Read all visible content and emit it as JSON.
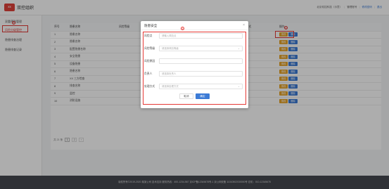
{
  "header": {
    "logo_text": "XX",
    "app_title": "双控组织",
    "user_text": "北京双控科技（示意）",
    "sep": "|",
    "user_name": "管理账号",
    "change_password": "修改密码",
    "logout": "退出"
  },
  "sidebar": {
    "items": [
      {
        "label": "双重预防管理"
      },
      {
        "label": "风险分级管控"
      },
      {
        "label": "隐患排查治理"
      },
      {
        "label": "隐患排查记录"
      }
    ],
    "mark": "①"
  },
  "table": {
    "headers": [
      "序号",
      "隐患名称",
      "风险等级",
      "所属单位",
      "排查方式",
      "操作"
    ],
    "rows": [
      {
        "no": "1",
        "name": "隐患名称",
        "level": "",
        "unit": "",
        "method": ""
      },
      {
        "no": "2",
        "name": "隐患名称",
        "level": "",
        "unit": "",
        "method": ""
      },
      {
        "no": "3",
        "name": "配置隐患名称",
        "level": "",
        "unit": "",
        "method": ""
      },
      {
        "no": "4",
        "name": "安全隐患",
        "level": "",
        "unit": "",
        "method": ""
      },
      {
        "no": "5",
        "name": "设备隐患",
        "level": "",
        "unit": "",
        "method": ""
      },
      {
        "no": "6",
        "name": "隐患名称",
        "level": "",
        "unit": "",
        "method": ""
      },
      {
        "no": "7",
        "name": "XX 三方检查",
        "level": "",
        "unit": "",
        "method": ""
      },
      {
        "no": "8",
        "name": "排查名称",
        "level": "",
        "unit": "",
        "method": ""
      },
      {
        "no": "9",
        "name": "监控",
        "level": "",
        "unit": "",
        "method": "日常"
      },
      {
        "no": "10",
        "name": "消防设施",
        "level": "",
        "unit": "",
        "method": "日常"
      }
    ],
    "edit_label": "修改",
    "delete_label": "删除",
    "op_mark": "②"
  },
  "pager": {
    "total": "共 21 条",
    "page1": "1",
    "page2": "2",
    "next": "›"
  },
  "footer": {
    "text": "版权所有©2019-2020 某某公司  技术支持  服务热线：400-1234-567  京ICP备12345678号-1  京公网安备 11010502030000号  总机：010-12345678"
  },
  "modal": {
    "title": "隐患安全",
    "close": "×",
    "mark": "③",
    "fields": [
      {
        "label": "风险点",
        "placeholder": "请输入风险点",
        "select": false
      },
      {
        "label": "风险等级",
        "placeholder": "请选择风险等级",
        "select": true
      },
      {
        "label": "风险原因",
        "placeholder": "",
        "select": false
      },
      {
        "label": "负责人",
        "placeholder": "请选择负责人",
        "select": false
      },
      {
        "label": "处理方式",
        "placeholder": "请选择处理方式",
        "select": true
      }
    ],
    "cancel": "取消",
    "confirm": "确定"
  },
  "colors": {
    "accent": "#3c7bd6",
    "brand": "#e0413a",
    "highlight": "#e53935",
    "edit": "#e8a52c"
  }
}
